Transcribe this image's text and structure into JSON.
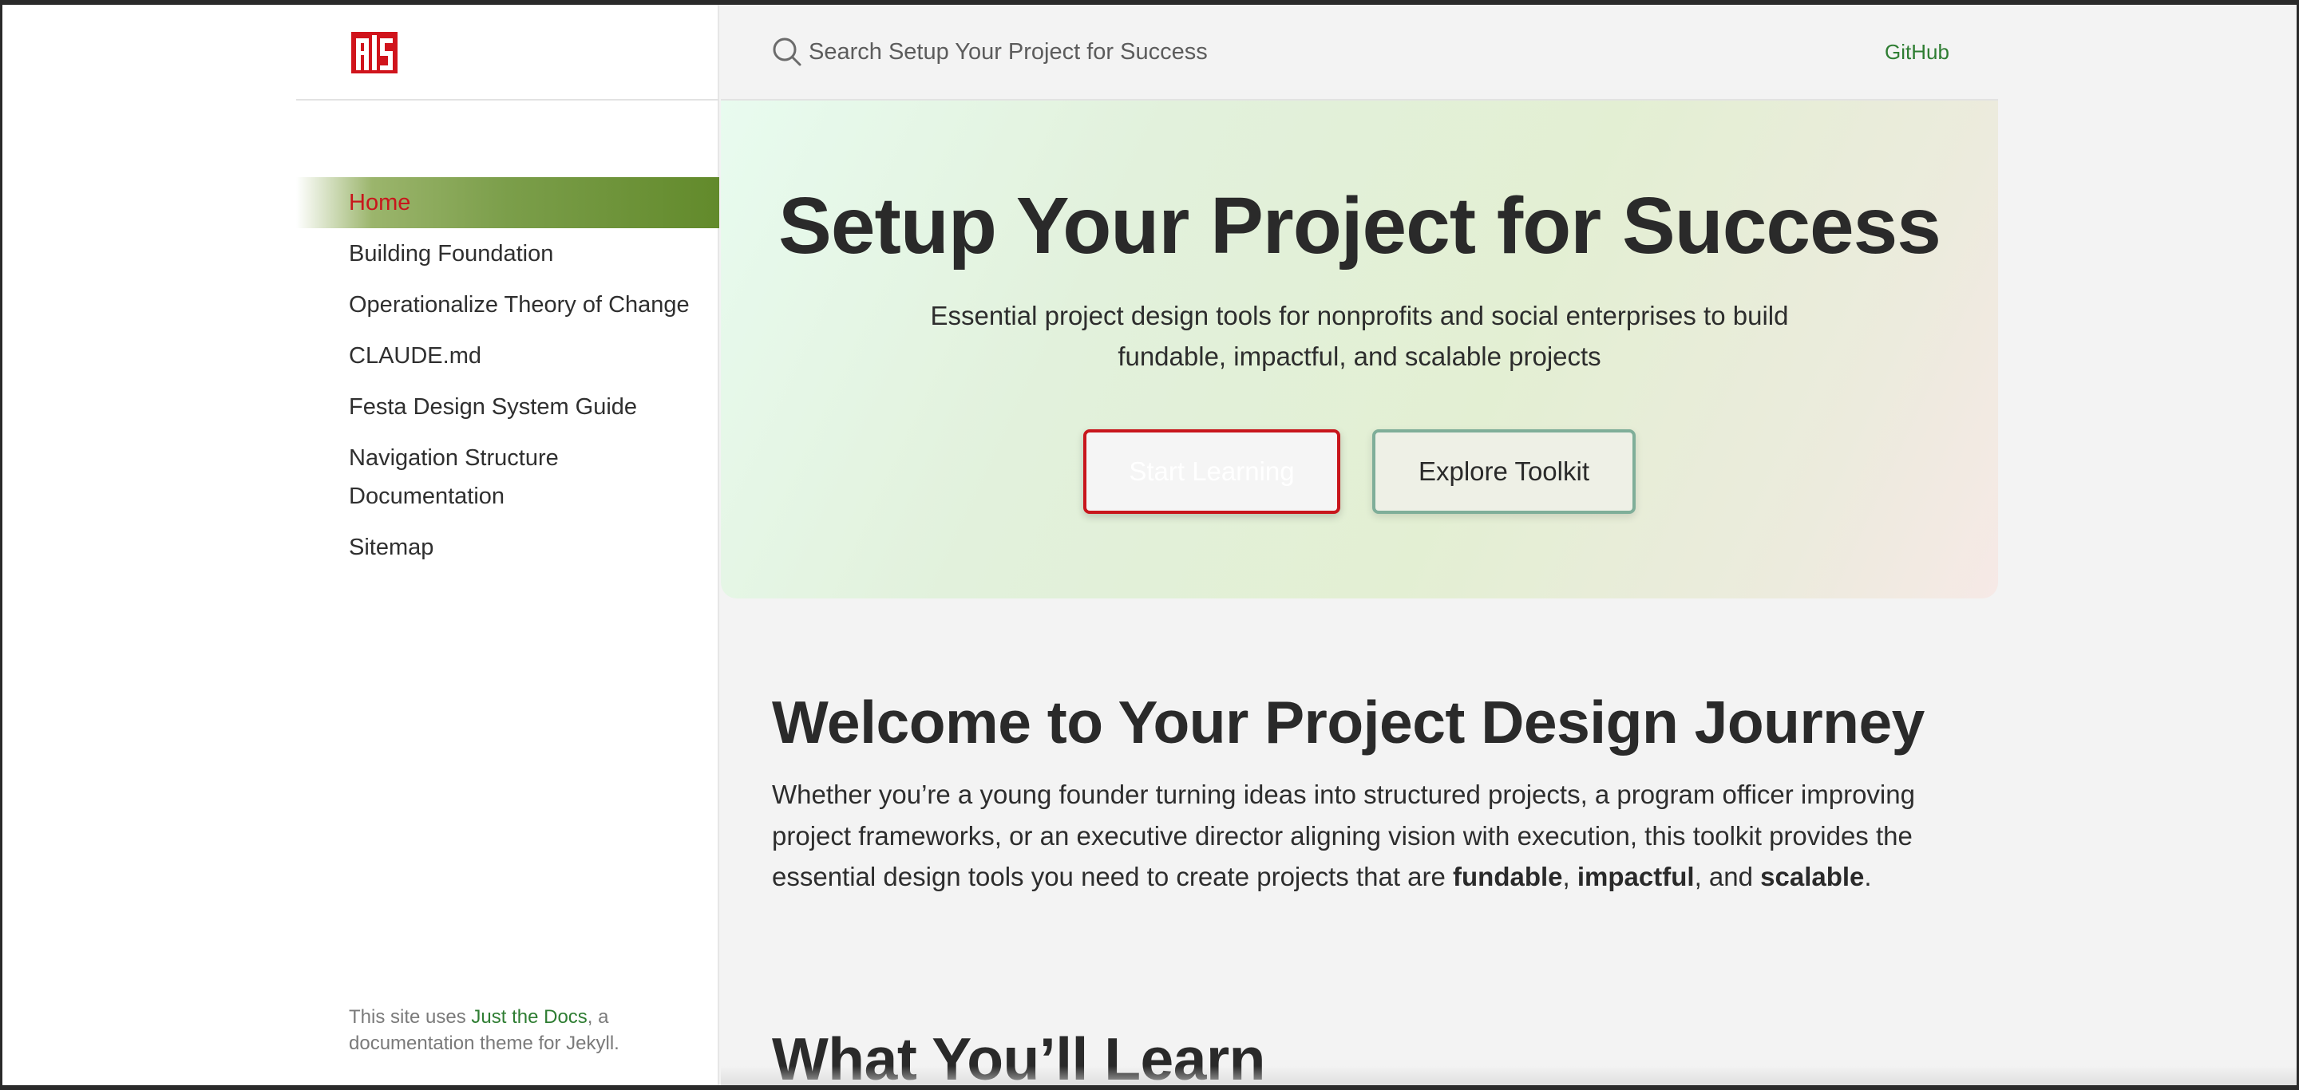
{
  "header": {
    "search_placeholder": "Search Setup Your Project for Success",
    "github_label": "GitHub"
  },
  "sidebar": {
    "items": [
      {
        "label": "Home"
      },
      {
        "label": "Building Foundation"
      },
      {
        "label": "Operationalize Theory of Change"
      },
      {
        "label": "CLAUDE.md"
      },
      {
        "label": "Festa Design System Guide"
      },
      {
        "label": "Navigation Structure Documentation"
      },
      {
        "label": "Sitemap"
      }
    ],
    "footer": {
      "prefix": "This site uses ",
      "link": "Just the Docs",
      "suffix": ", a documentation theme for Jekyll."
    }
  },
  "hero": {
    "title": "Setup Your Project for Success",
    "subtitle": "Essential project design tools for nonprofits and social enterprises to build fundable, impactful, and scalable projects",
    "start_button": "Start Learning",
    "explore_button": "Explore Toolkit"
  },
  "content": {
    "welcome_heading": "Welcome to Your Project Design Journey",
    "intro_text": "Whether you’re a young founder turning ideas into structured projects, a program officer improving project frameworks, or an executive director aligning vision with execution, this toolkit provides the essential design tools you need to create projects that are ",
    "bold_1": "fundable",
    "sep_1": ", ",
    "bold_2": "impactful",
    "sep_2": ", and ",
    "bold_3": "scalable",
    "end": ".",
    "learn_heading": "What You’ll Learn"
  },
  "colors": {
    "accent_red": "#c8161c",
    "accent_green": "#628a2b",
    "link_green": "#2e7d32"
  }
}
